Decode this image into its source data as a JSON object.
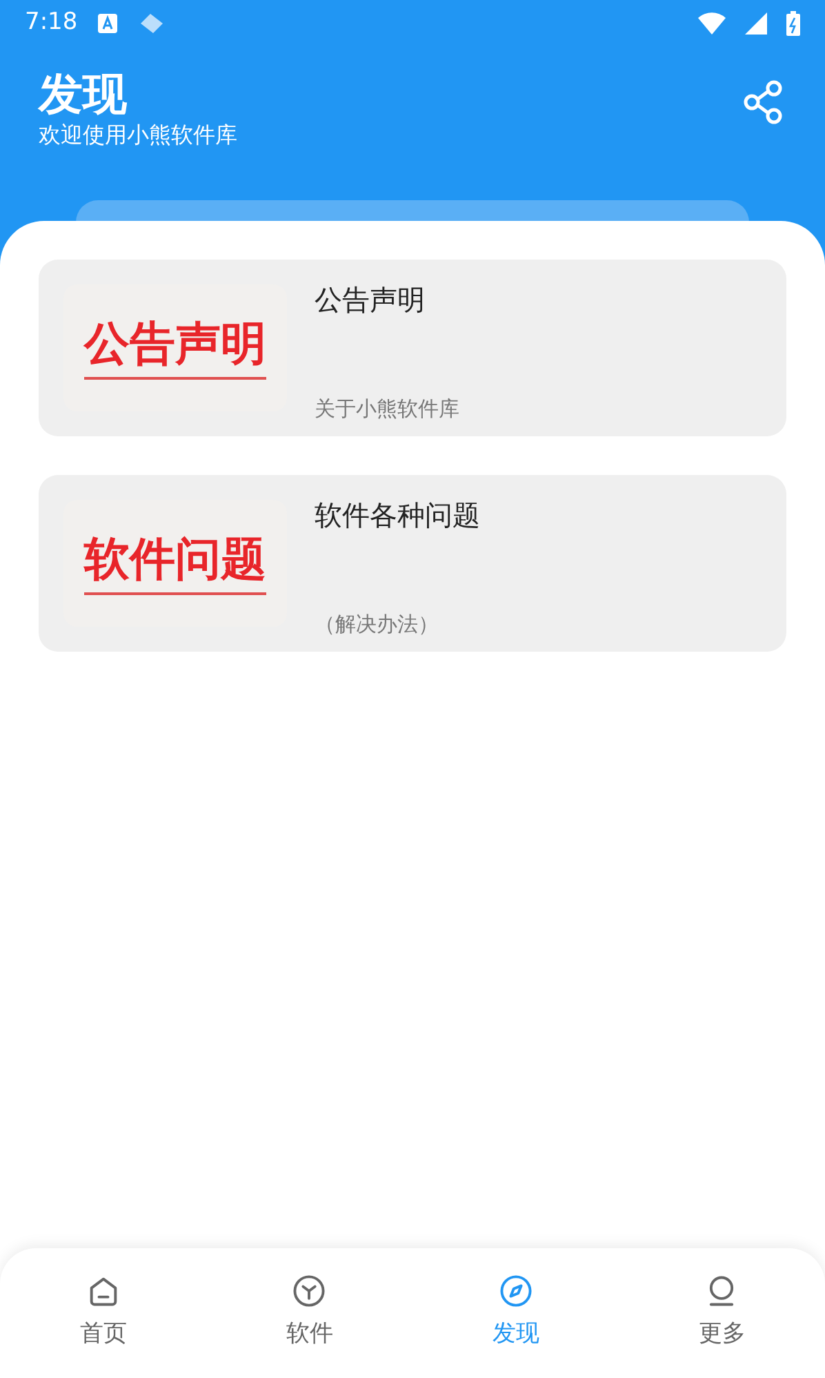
{
  "status_bar": {
    "time": "7:18"
  },
  "header": {
    "title": "发现",
    "subtitle": "欢迎使用小熊软件库"
  },
  "cards": [
    {
      "thumbnail_text": "公告声明",
      "title": "公告声明",
      "subtitle": "关于小熊软件库"
    },
    {
      "thumbnail_text": "软件问题",
      "title": "软件各种问题",
      "subtitle": "（解决办法）"
    }
  ],
  "nav": [
    {
      "kind": "home",
      "label": "首页",
      "selected": false
    },
    {
      "kind": "box",
      "label": "软件",
      "selected": false
    },
    {
      "kind": "compass",
      "label": "发现",
      "selected": true
    },
    {
      "kind": "person",
      "label": "更多",
      "selected": false
    }
  ]
}
